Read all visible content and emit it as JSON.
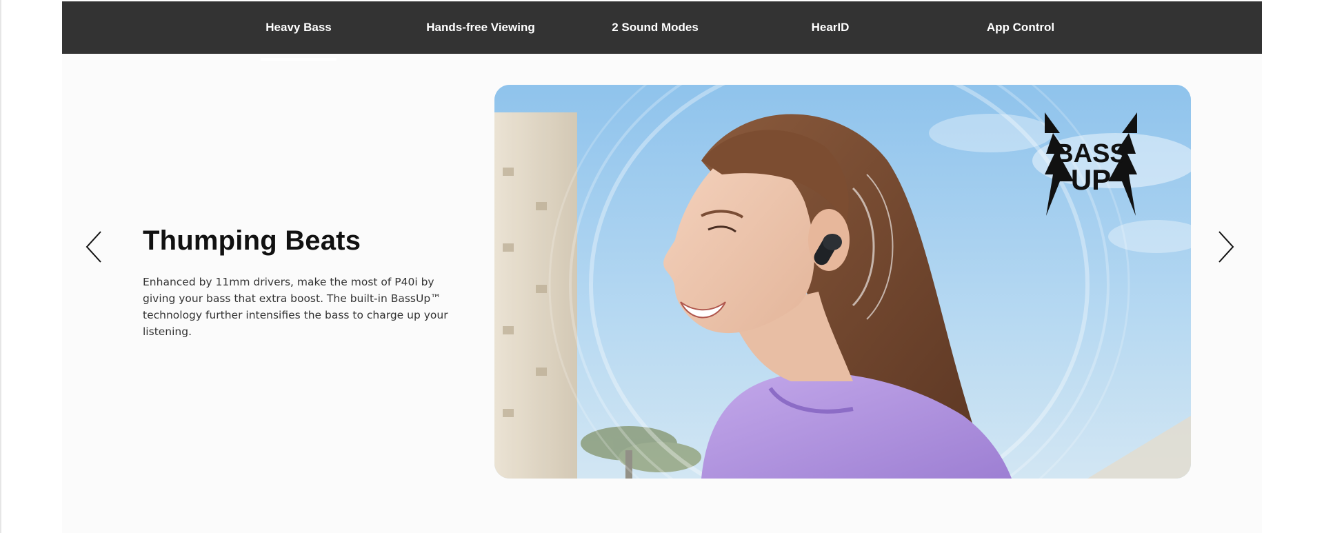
{
  "nav": {
    "tabs": [
      {
        "label": "Heavy Bass",
        "active": true
      },
      {
        "label": "Hands-free Viewing",
        "active": false
      },
      {
        "label": "2 Sound Modes",
        "active": false
      },
      {
        "label": "HearID",
        "active": false
      },
      {
        "label": "App Control",
        "active": false
      }
    ]
  },
  "slide": {
    "title": "Thumping Beats",
    "description": "Enhanced by 11mm drivers, make the most of P40i by giving your bass that extra boost. The built-in BassUp™ technology further intensifies the bass to charge up your listening.",
    "badge": {
      "line1": "BASS",
      "line2": "UP"
    }
  },
  "icons": {
    "prev": "chevron-left-icon",
    "next": "chevron-right-icon",
    "badge": "bassup-logo-icon"
  },
  "colors": {
    "nav_bg": "#333333",
    "nav_text": "#ffffff",
    "page_bg": "#fbfbfb",
    "title": "#111111",
    "body_text": "#333333",
    "hoodie": "#b89be0",
    "sky": "#a9d0f0"
  }
}
